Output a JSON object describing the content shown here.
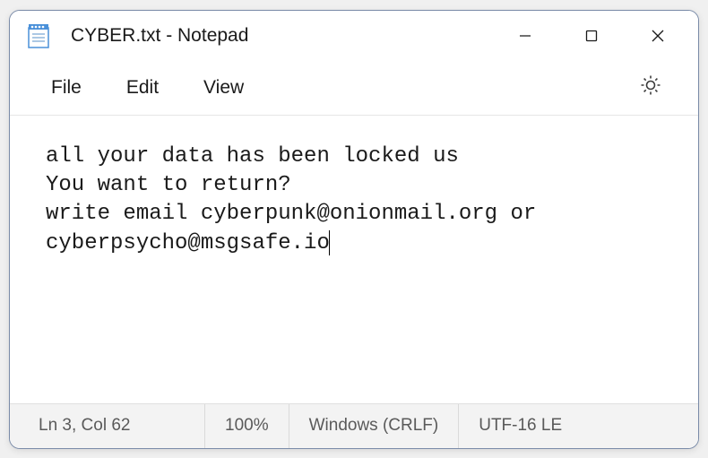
{
  "titlebar": {
    "title": "CYBER.txt - Notepad"
  },
  "menubar": {
    "file": "File",
    "edit": "Edit",
    "view": "View"
  },
  "content": {
    "text": "all your data has been locked us\nYou want to return?\nwrite email cyberpunk@onionmail.org or cyberpsycho@msgsafe.io"
  },
  "statusbar": {
    "position": "Ln 3, Col 62",
    "zoom": "100%",
    "encoding": "Windows (CRLF)",
    "charset": "UTF-16 LE"
  }
}
